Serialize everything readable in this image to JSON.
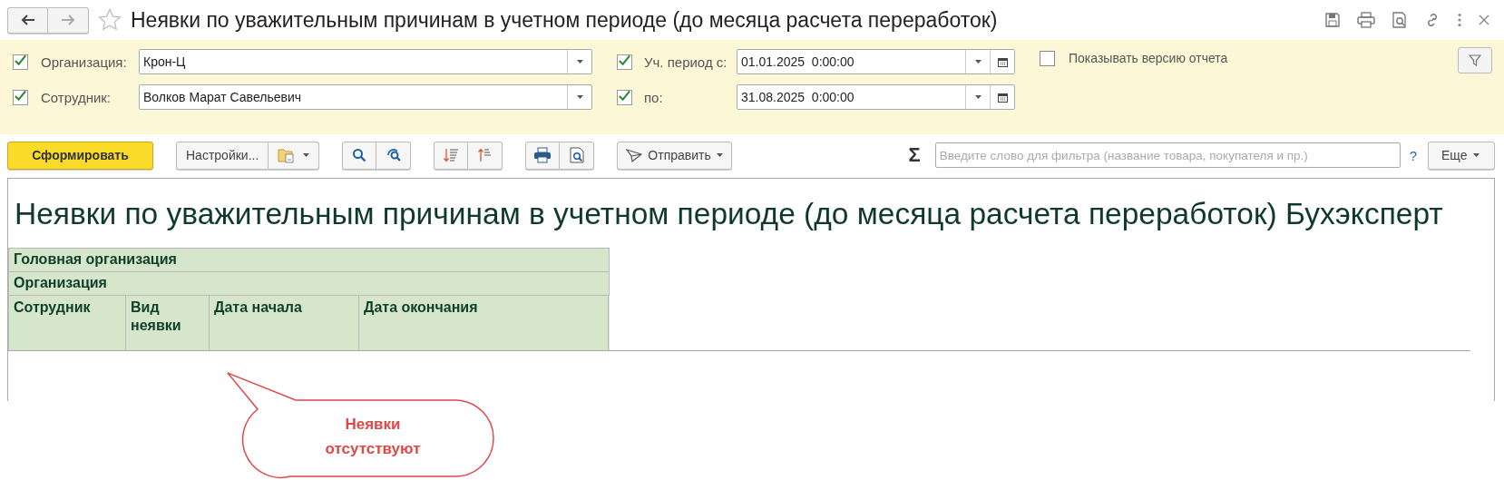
{
  "window": {
    "title": "Неявки по уважительным причинам в учетном периоде (до месяца расчета переработок)"
  },
  "filters": {
    "left": [
      {
        "label": "Организация:",
        "value": "Крон-Ц",
        "checked": true
      },
      {
        "label": "Сотрудник:",
        "value": "Волков Марат Савельевич",
        "checked": true
      }
    ],
    "period": [
      {
        "label": "Уч. период с:",
        "value": "01.01.2025  0:00:00",
        "checked": true
      },
      {
        "label": "по:",
        "value": "31.08.2025  0:00:00",
        "checked": true
      }
    ],
    "show_version": {
      "label": "Показывать версию отчета",
      "checked": false
    }
  },
  "toolbar": {
    "generate": "Сформировать",
    "settings": "Настройки...",
    "send": "Отправить",
    "sum": "Σ",
    "search_placeholder": "Введите слово для фильтра (название товара, покупателя и пр.)",
    "help": "?",
    "more": "Еще"
  },
  "report": {
    "title": "Неявки по уважительным причинам в учетном периоде (до месяца расчета переработок) Бухэксперт",
    "header_rows": [
      "Головная организация",
      "Организация"
    ],
    "columns": [
      "Сотрудник",
      "Вид неявки",
      "Дата начала",
      "Дата окончания"
    ]
  },
  "callout": {
    "text": "Неявки отсутствуют"
  }
}
